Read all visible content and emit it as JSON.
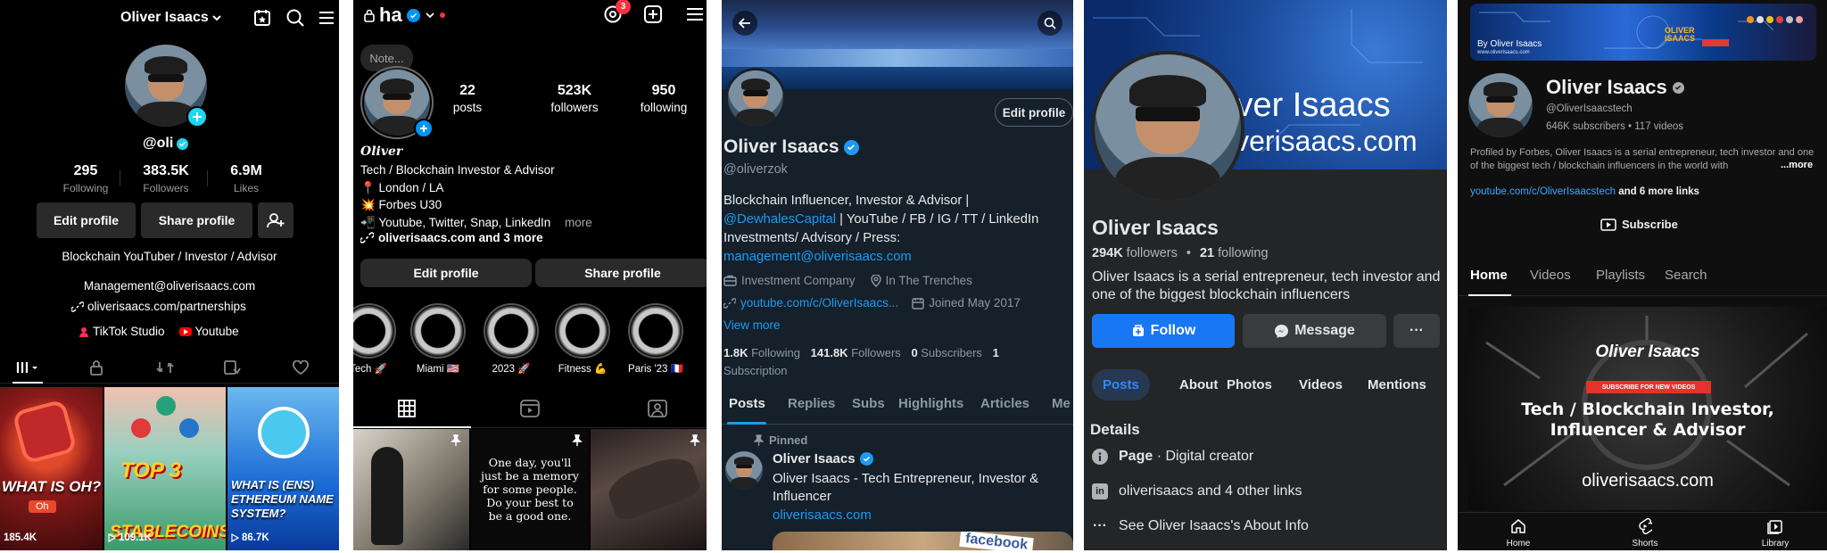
{
  "tiktok": {
    "username_title": "Oliver Isaacs",
    "handle": "@oli",
    "stats": [
      {
        "value": "295",
        "label": "Following"
      },
      {
        "value": "383.5K",
        "label": "Followers"
      },
      {
        "value": "6.9M",
        "label": "Likes"
      }
    ],
    "edit_profile": "Edit profile",
    "share_profile": "Share profile",
    "bio": "Blockchain YouTuber / Investor / Advisor",
    "email": "Management@oliverisaacs.com",
    "link": "oliverisaacs.com/partnerships",
    "studio": "TikTok Studio",
    "youtube": "Youtube",
    "videos": [
      {
        "caption": "WHAT IS OH?",
        "sub": "Oh",
        "views": "185.4K",
        "bg": "#8a1a1a"
      },
      {
        "caption": "TOP 3",
        "sub": "STABLECOINS",
        "views": "109.1K",
        "bg": "#3a9a6a"
      },
      {
        "caption": "WHAT IS (ENS) ETHEREUM NAME SYSTEM?",
        "sub": "",
        "views": "86.7K",
        "bg": "#1a6ad6"
      }
    ]
  },
  "instagram": {
    "username": "ha",
    "notification_count": "3",
    "note": "Note...",
    "name_script": "Oliver",
    "stats": [
      {
        "value": "22",
        "label": "posts"
      },
      {
        "value": "523K",
        "label": "followers"
      },
      {
        "value": "950",
        "label": "following"
      }
    ],
    "bio_lines": [
      "Tech / Blockchain Investor & Advisor",
      "📍 London / LA",
      "💥 Forbes U30",
      "📲 Youtube, Twitter, Snap, LinkedIn"
    ],
    "more": "more",
    "link": "oliverisaacs.com and 3 more",
    "edit_profile": "Edit profile",
    "share_profile": "Share profile",
    "highlights": [
      "Tech 🚀",
      "Miami 🇺🇸",
      "2023 🚀",
      "Fitness 💪",
      "Paris '23 🇫🇷"
    ],
    "quote": "One day, you'll just be a memory for some people. Do your best to be a good one."
  },
  "x": {
    "name": "Oliver Isaacs",
    "handle": "@oliverzok",
    "edit_profile": "Edit profile",
    "bio_1": "Blockchain Influencer, Investor & Advisor |",
    "bio_mention": "@DewhalesCapital",
    "bio_2": " | YouTube / FB / IG / TT / LinkedIn",
    "bio_3": "Investments/ Advisory / Press:",
    "bio_email": "management@oliverisaacs.com",
    "category": "Investment Company",
    "location": "In The Trenches",
    "url": "youtube.com/c/OliverIsaacs...",
    "joined": "Joined May 2017",
    "view_more": "View more",
    "following_count": "1.8K",
    "following_label": "Following",
    "followers_count": "141.8K",
    "followers_label": "Followers",
    "subscribers_count": "0",
    "subscribers_label": "Subscribers",
    "subscription_count": "1",
    "subscription_label": "Subscription",
    "tabs": [
      "Posts",
      "Replies",
      "Subs",
      "Highlights",
      "Articles",
      "Me"
    ],
    "pinned": "Pinned",
    "post_name": "Oliver Isaacs",
    "post_text": "Oliver Isaacs - Tech Entrepreneur, Investor & Influencer",
    "post_link": "oliverisaacs.com",
    "media_text": "facebook"
  },
  "facebook": {
    "cover_line1": "iver Isaacs",
    "cover_line2": "iverisaacs.com",
    "name": "Oliver Isaacs",
    "followers": "294K",
    "followers_label": "followers",
    "following": "21",
    "following_label": "following",
    "bio": "Oliver Isaacs is a serial entrepreneur, tech investor and one of the biggest blockchain influencers",
    "follow": "Follow",
    "message": "Message",
    "more": "···",
    "tabs": [
      "Posts",
      "About",
      "Photos",
      "Videos",
      "Mentions"
    ],
    "details_title": "Details",
    "page_label": "Page",
    "page_type": " · Digital creator",
    "links": "oliverisaacs and 4 other links",
    "about": "See Oliver Isaacs's About Info"
  },
  "youtube": {
    "banner_text1": "By Oliver Isaacs",
    "banner_text2": "www.oliverisaacs.com",
    "banner_logo": "OLIVER ISAACS",
    "name": "Oliver Isaacs",
    "handle": "@OliverIsaacstech",
    "stats": "646K subscribers • 117 videos",
    "description": "Profiled by Forbes, Oliver Isaacs is a serial entrepreneur, tech investor and one of the biggest tech / blockchain influencers in the world with",
    "desc_more": "...more",
    "link": "youtube.com/c/OliverIsaacstech",
    "link_more": " and 6 more links",
    "subscribe": "Subscribe",
    "tabs": [
      "Home",
      "Videos",
      "Playlists",
      "Search"
    ],
    "feature_title": "Oliver Isaacs",
    "feature_badge": "SUBSCRIBE FOR NEW VIDEOS",
    "feature_line1": "Tech / Blockchain Investor,",
    "feature_line2": "Influencer & Advisor",
    "feature_url": "oliverisaacs.com",
    "nav": [
      "Home",
      "Shorts",
      "Library"
    ]
  }
}
